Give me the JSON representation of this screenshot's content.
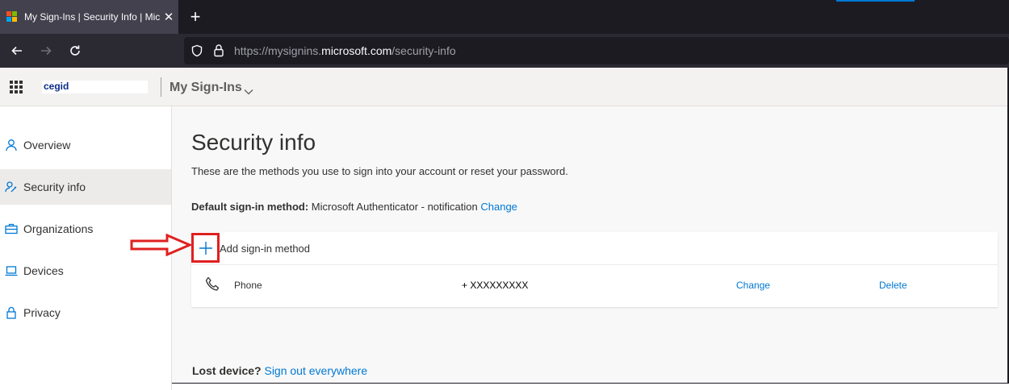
{
  "browser": {
    "tab_title": "My Sign-Ins | Security Info | Mic",
    "new_tab_icon": "plus-icon",
    "url_prefix": "https://mysignins.",
    "url_domain": "microsoft.com",
    "url_path": "/security-info"
  },
  "header": {
    "org_name": "cegid",
    "app_title": "My Sign-Ins"
  },
  "sidebar": {
    "items": [
      {
        "label": "Overview",
        "icon": "person-icon"
      },
      {
        "label": "Security info",
        "icon": "person-key-icon"
      },
      {
        "label": "Organizations",
        "icon": "briefcase-icon"
      },
      {
        "label": "Devices",
        "icon": "laptop-icon"
      },
      {
        "label": "Privacy",
        "icon": "lock-icon"
      }
    ]
  },
  "main": {
    "title": "Security info",
    "subtitle": "These are the methods you use to sign into your account or reset your password.",
    "default_method_label": "Default sign-in method:",
    "default_method_value": "Microsoft Authenticator - notification",
    "default_method_change": "Change",
    "add_method_label": "Add sign-in method",
    "methods": [
      {
        "type": "Phone",
        "value": "+ XXXXXXXXX",
        "change": "Change",
        "delete": "Delete"
      }
    ],
    "lost_device_label": "Lost device?",
    "lost_device_link": "Sign out everywhere"
  },
  "colors": {
    "accent": "#0078d4",
    "annotation": "#e02020",
    "active_nav": "#edebe9"
  }
}
